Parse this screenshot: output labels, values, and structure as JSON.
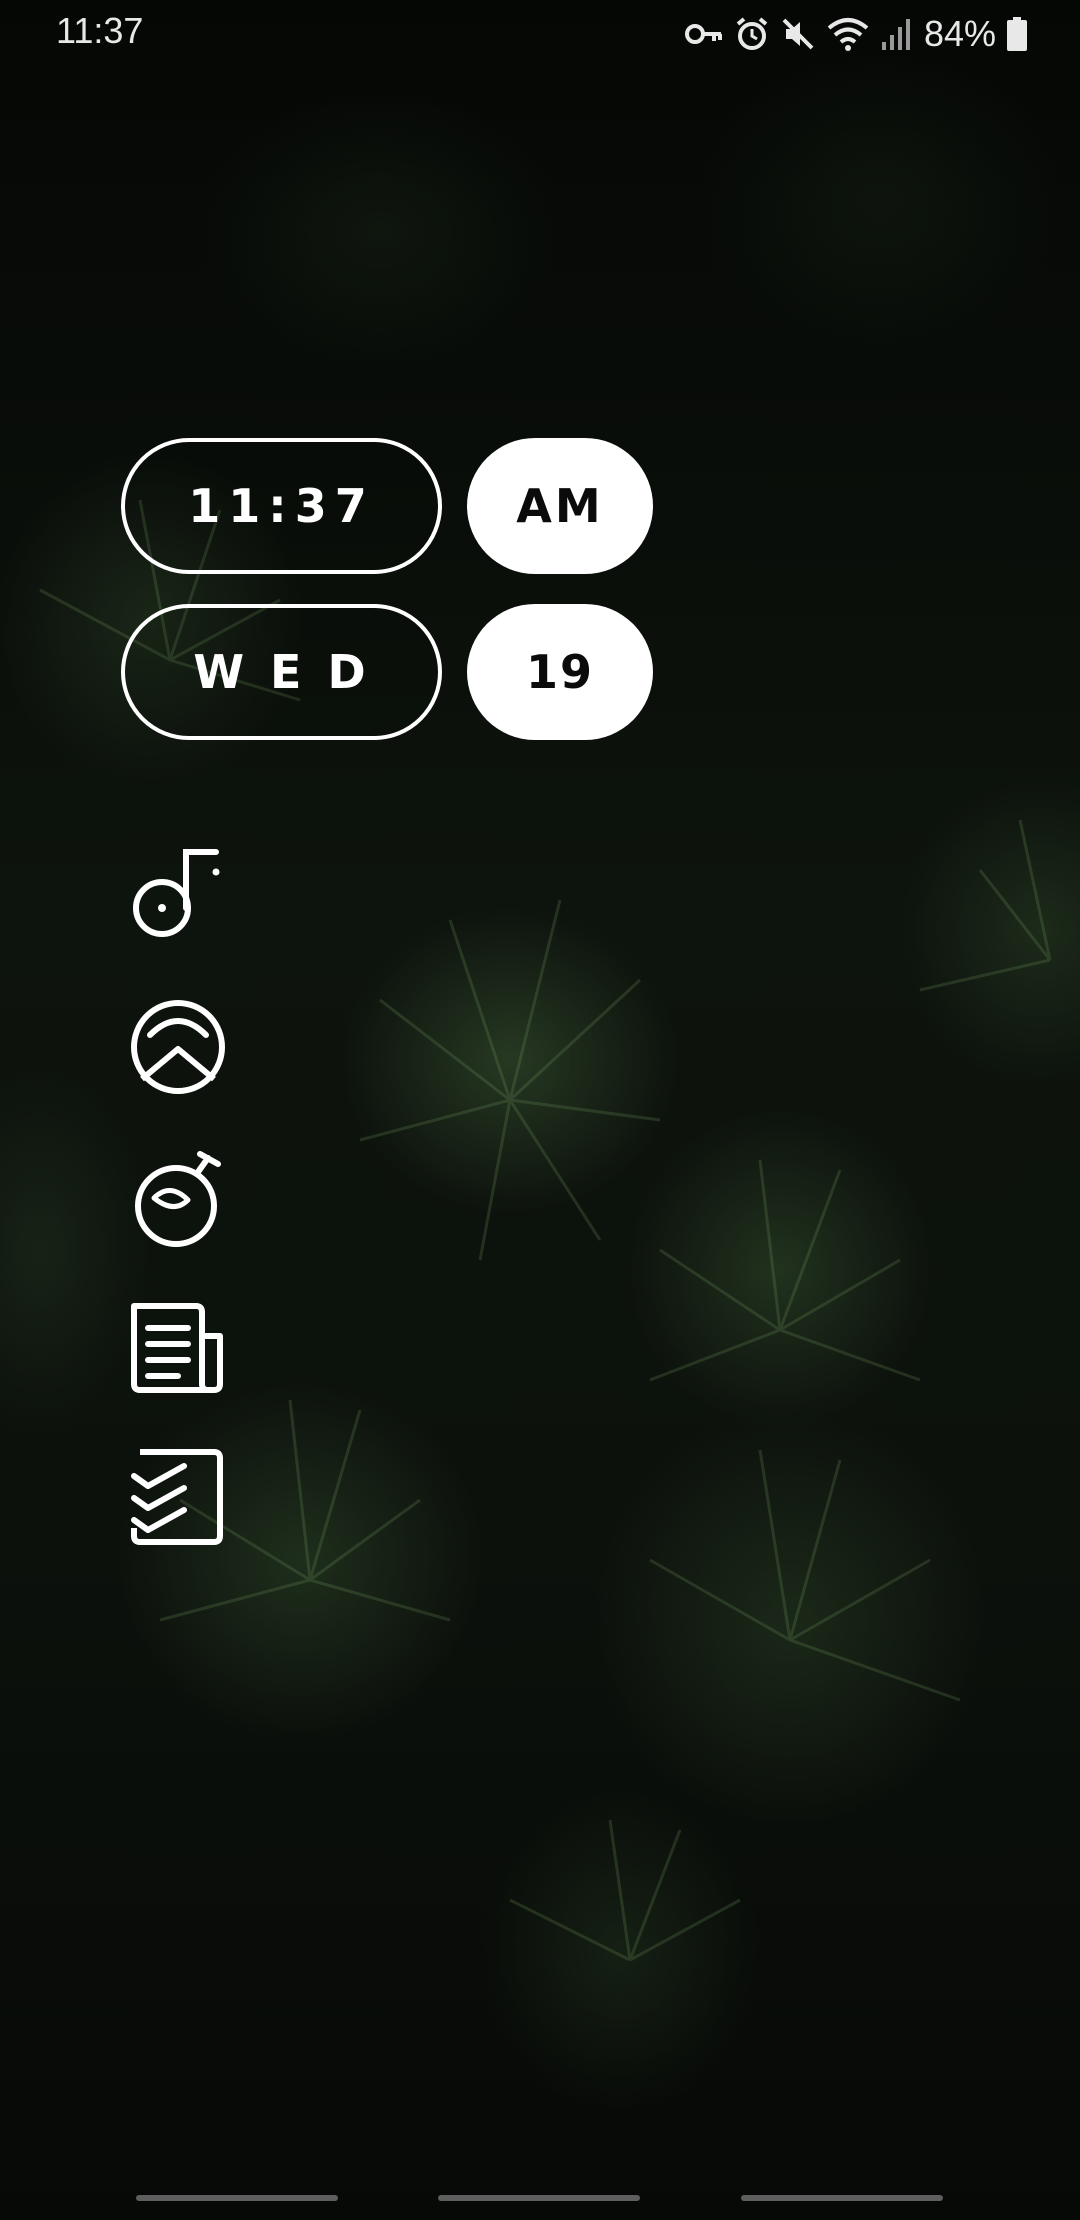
{
  "status_bar": {
    "time": "11:37",
    "battery": "84%",
    "icons": [
      "vpn-key-icon",
      "alarm-icon",
      "mute-icon",
      "wifi-icon",
      "signal-icon",
      "battery-icon"
    ]
  },
  "clock_widget": {
    "time": "11:37",
    "ampm": "AM",
    "day": "WED",
    "date": "19"
  },
  "apps": [
    {
      "icon": "music-icon"
    },
    {
      "icon": "maps-icon"
    },
    {
      "icon": "stopwatch-icon"
    },
    {
      "icon": "news-icon"
    },
    {
      "icon": "tasks-icon"
    }
  ],
  "colors": {
    "accent": "#ffffff",
    "background": "#0b0f0b"
  }
}
